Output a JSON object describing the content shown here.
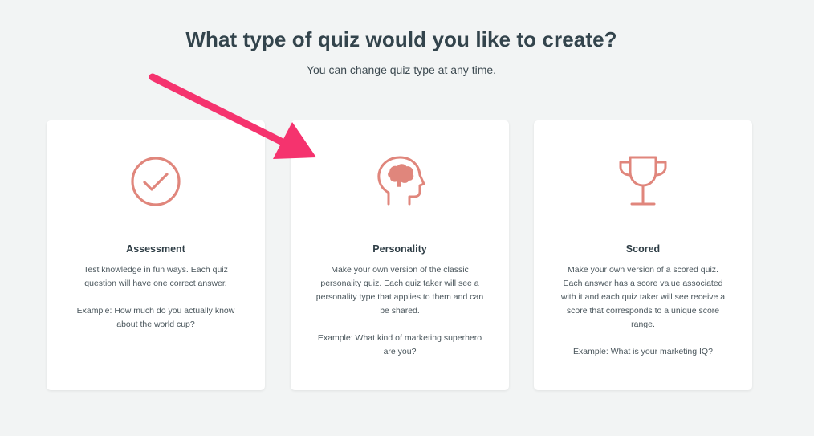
{
  "header": {
    "title": "What type of quiz would you like to create?",
    "subtitle": "You can change quiz type at any time."
  },
  "colors": {
    "icon": "#e0867c",
    "arrow": "#f5336e",
    "background": "#f2f4f4"
  },
  "cards": [
    {
      "icon": "check-circle-icon",
      "title": "Assessment",
      "description": "Test knowledge in fun ways. Each quiz question will have one correct answer.",
      "example": "Example: How much do you actually know about the world cup?"
    },
    {
      "icon": "brain-head-icon",
      "title": "Personality",
      "description": "Make your own version of the classic personality quiz. Each quiz taker will see a personality type that applies to them and can be shared.",
      "example": "Example: What kind of marketing superhero are you?"
    },
    {
      "icon": "trophy-icon",
      "title": "Scored",
      "description": "Make your own version of a scored quiz. Each answer has a score value associated with it and each quiz taker will see receive a score that corresponds to a unique score range.",
      "example": "Example: What is your marketing IQ?"
    }
  ]
}
